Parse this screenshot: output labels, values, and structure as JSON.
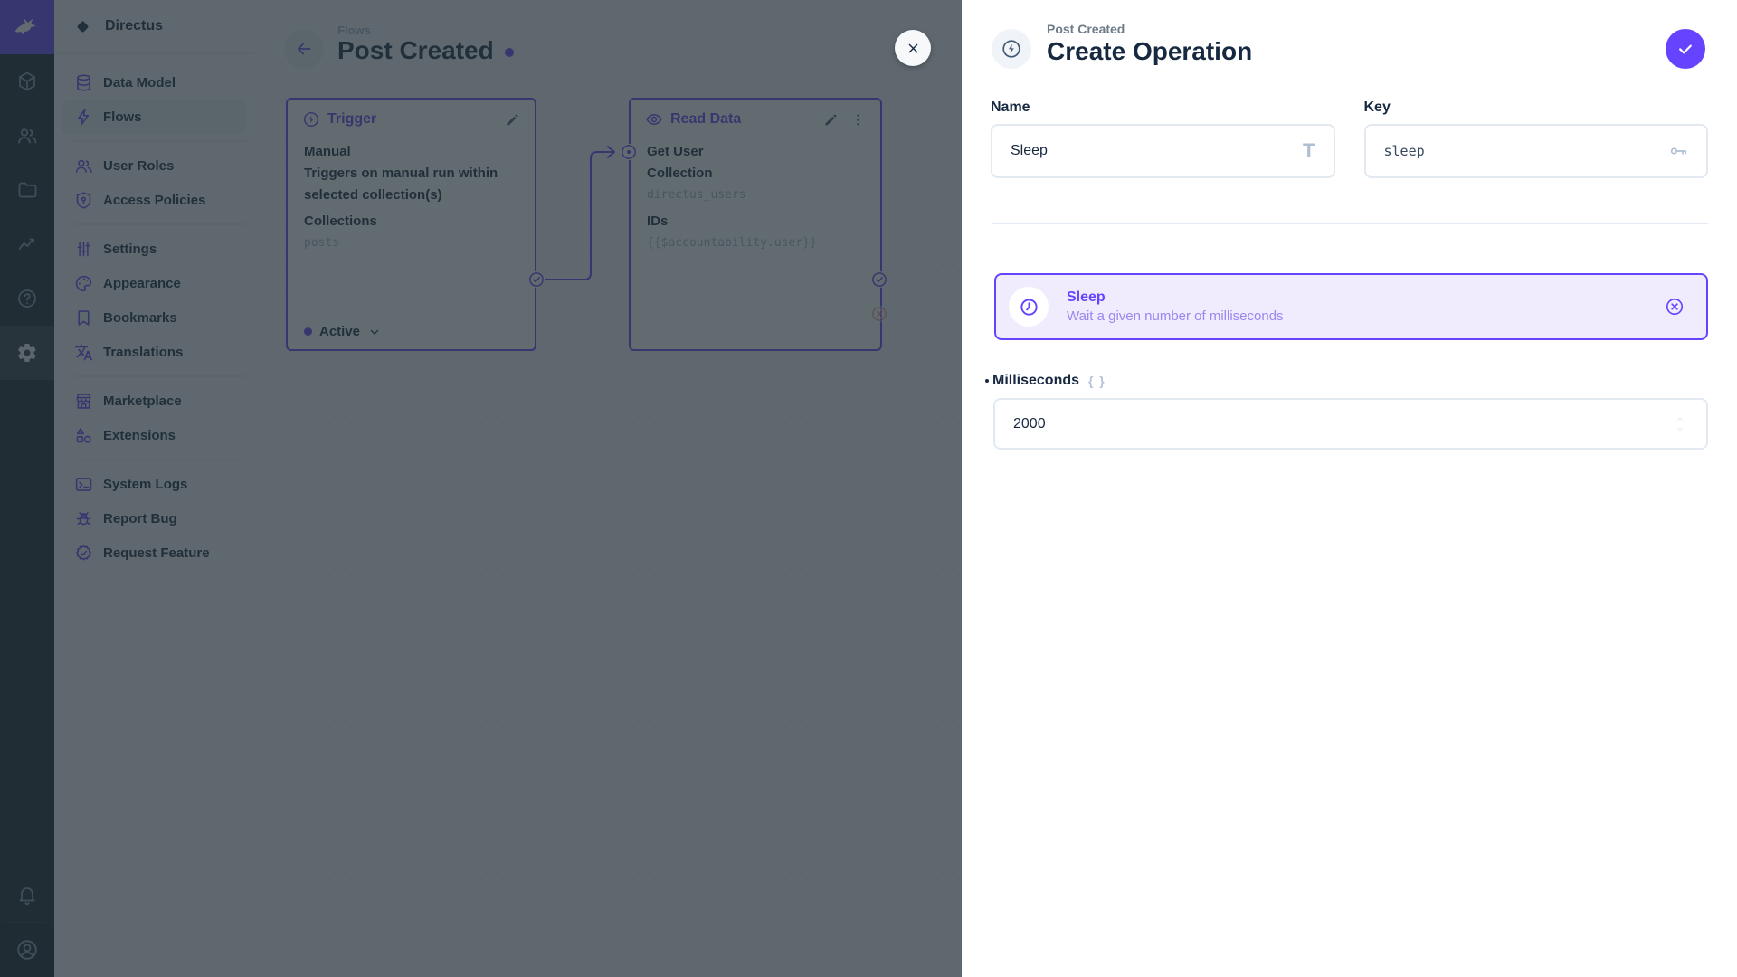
{
  "colors": {
    "accent": "#6644FF",
    "text_dark": "#172940",
    "text_subdued": "#A2B5CD",
    "module_bar_bg": "#18222F",
    "reject": "#E35D75"
  },
  "module_bar": {
    "modules": [
      {
        "icon": "box-icon",
        "name": "content-module",
        "active": false
      },
      {
        "icon": "users-icon",
        "name": "users-module",
        "active": false
      },
      {
        "icon": "folder-icon",
        "name": "files-module",
        "active": false
      },
      {
        "icon": "insights-icon",
        "name": "insights-module",
        "active": false
      },
      {
        "icon": "help-icon",
        "name": "docs-module",
        "active": false
      },
      {
        "icon": "settings-gear-icon",
        "name": "settings-module",
        "active": true
      }
    ]
  },
  "nav": {
    "project_name": "Directus",
    "groups": [
      {
        "items": [
          {
            "icon": "database-icon",
            "label": "Data Model",
            "active": false
          },
          {
            "icon": "bolt-icon",
            "label": "Flows",
            "active": true
          }
        ]
      },
      {
        "items": [
          {
            "icon": "users-icon",
            "label": "User Roles",
            "active": false
          },
          {
            "icon": "shield-icon",
            "label": "Access Policies",
            "active": false
          }
        ]
      },
      {
        "items": [
          {
            "icon": "sliders-icon",
            "label": "Settings",
            "active": false
          },
          {
            "icon": "palette-icon",
            "label": "Appearance",
            "active": false
          },
          {
            "icon": "bookmark-icon",
            "label": "Bookmarks",
            "active": false
          },
          {
            "icon": "translate-icon",
            "label": "Translations",
            "active": false
          }
        ]
      },
      {
        "items": [
          {
            "icon": "storefront-icon",
            "label": "Marketplace",
            "active": false
          },
          {
            "icon": "extensions-icon",
            "label": "Extensions",
            "active": false
          }
        ]
      },
      {
        "items": [
          {
            "icon": "terminal-icon",
            "label": "System Logs",
            "active": false
          },
          {
            "icon": "bug-icon",
            "label": "Report Bug",
            "active": false
          },
          {
            "icon": "badge-check-icon",
            "label": "Request Feature",
            "active": false
          }
        ]
      }
    ]
  },
  "flow": {
    "breadcrumb": "Flows",
    "title": "Post Created",
    "trigger_card": {
      "header": "Trigger",
      "type": "Manual",
      "description": "Triggers on manual run within selected collection(s)",
      "option_label": "Collections",
      "option_value": "posts",
      "status": "Active"
    },
    "operation_card": {
      "header": "Read Data",
      "name": "Get User",
      "fields": [
        {
          "label": "Collection",
          "value": "directus_users"
        },
        {
          "label": "IDs",
          "value": "{{$accountability.user}}"
        }
      ]
    }
  },
  "drawer": {
    "breadcrumb": "Post Created",
    "title": "Create Operation",
    "name_field": {
      "label": "Name",
      "value": "Sleep"
    },
    "key_field": {
      "label": "Key",
      "value": "sleep"
    },
    "operation": {
      "title": "Sleep",
      "subtitle": "Wait a given number of milliseconds"
    },
    "milliseconds_field": {
      "label": "Milliseconds",
      "value": "2000"
    }
  }
}
